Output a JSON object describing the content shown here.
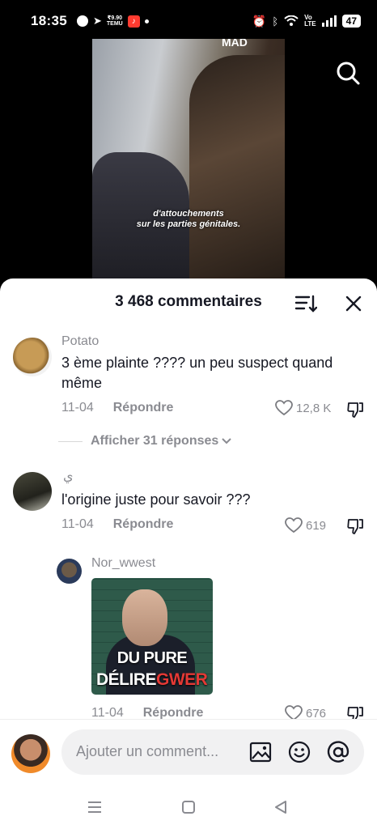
{
  "status_bar": {
    "time": "18:35",
    "temu_label": "₹9.90\nTEMU",
    "music_glyph": "♪",
    "network": "Vo\nLTE",
    "battery": "47"
  },
  "video": {
    "brand_text": "MAD",
    "caption_line1": "d'attouchements",
    "caption_line2": "sur les parties génitales."
  },
  "comments_panel": {
    "title": "3 468 commentaires",
    "comments": [
      {
        "user": "Potato",
        "text": "3 ème plainte ???? un peu suspect quand même",
        "date": "11-04",
        "reply_label": "Répondre",
        "likes": "12,8 K",
        "view_replies": "Afficher 31 réponses"
      },
      {
        "user": "ي",
        "text": "l'origine juste pour savoir ???",
        "date": "11-04",
        "reply_label": "Répondre",
        "likes": "619"
      },
      {
        "user": "Nor_wwest",
        "image_text_line1": "DU PURE",
        "image_text_line2_white": "DÉLIRE",
        "image_text_line2_red": "GWER",
        "date": "11-04",
        "reply_label": "Répondre",
        "likes": "676"
      }
    ]
  },
  "input_bar": {
    "placeholder": "Ajouter un comment..."
  },
  "colors": {
    "text_primary": "#161823",
    "text_secondary": "#8a8b91",
    "accent_red": "#e53935"
  }
}
